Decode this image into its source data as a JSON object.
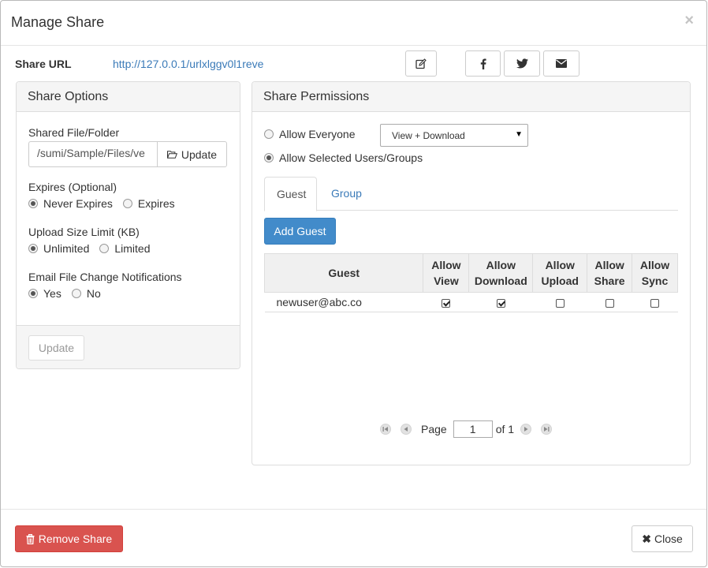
{
  "modal": {
    "title": "Manage Share",
    "close_glyph": "×"
  },
  "share_url": {
    "label": "Share URL",
    "value": "http://127.0.0.1/urlxlggv0l1reve"
  },
  "toolbar_icons": [
    "edit-icon",
    "facebook-icon",
    "twitter-icon",
    "email-icon"
  ],
  "share_options": {
    "heading": "Share Options",
    "shared_path_label": "Shared File/Folder",
    "shared_path_value": "/sumi/Sample/Files/ve",
    "update_path_button": "Update",
    "expires_label": "Expires (Optional)",
    "expires_options": [
      {
        "label": "Never Expires",
        "checked": true
      },
      {
        "label": "Expires",
        "checked": false
      }
    ],
    "upload_limit_label": "Upload Size Limit (KB)",
    "upload_limit_options": [
      {
        "label": "Unlimited",
        "checked": true
      },
      {
        "label": "Limited",
        "checked": false
      }
    ],
    "notify_label": "Email File Change Notifications",
    "notify_options": [
      {
        "label": "Yes",
        "checked": true
      },
      {
        "label": "No",
        "checked": false
      }
    ],
    "footer_update_button": "Update"
  },
  "share_permissions": {
    "heading": "Share Permissions",
    "allow_everyone_label": "Allow Everyone",
    "allow_everyone_checked": false,
    "everyone_select_value": "View + Download",
    "allow_selected_label": "Allow Selected Users/Groups",
    "allow_selected_checked": true,
    "tabs": [
      {
        "label": "Guest",
        "active": true
      },
      {
        "label": "Group",
        "active": false
      }
    ],
    "add_guest_button": "Add Guest",
    "table": {
      "headers": [
        "Guest",
        "Allow View",
        "Allow Download",
        "Allow Upload",
        "Allow Share",
        "Allow Sync"
      ],
      "rows": [
        {
          "guest": "newuser@abc.co",
          "view": true,
          "download": true,
          "upload": false,
          "share": false,
          "sync": false
        }
      ]
    },
    "pager": {
      "page_label": "Page",
      "current_page": "1",
      "of_label": "of 1"
    }
  },
  "footer": {
    "remove_share_button": "Remove Share",
    "close_button": "Close"
  },
  "colors": {
    "link": "#3a7ab8",
    "primary": "#428bca",
    "danger": "#d9534f"
  }
}
